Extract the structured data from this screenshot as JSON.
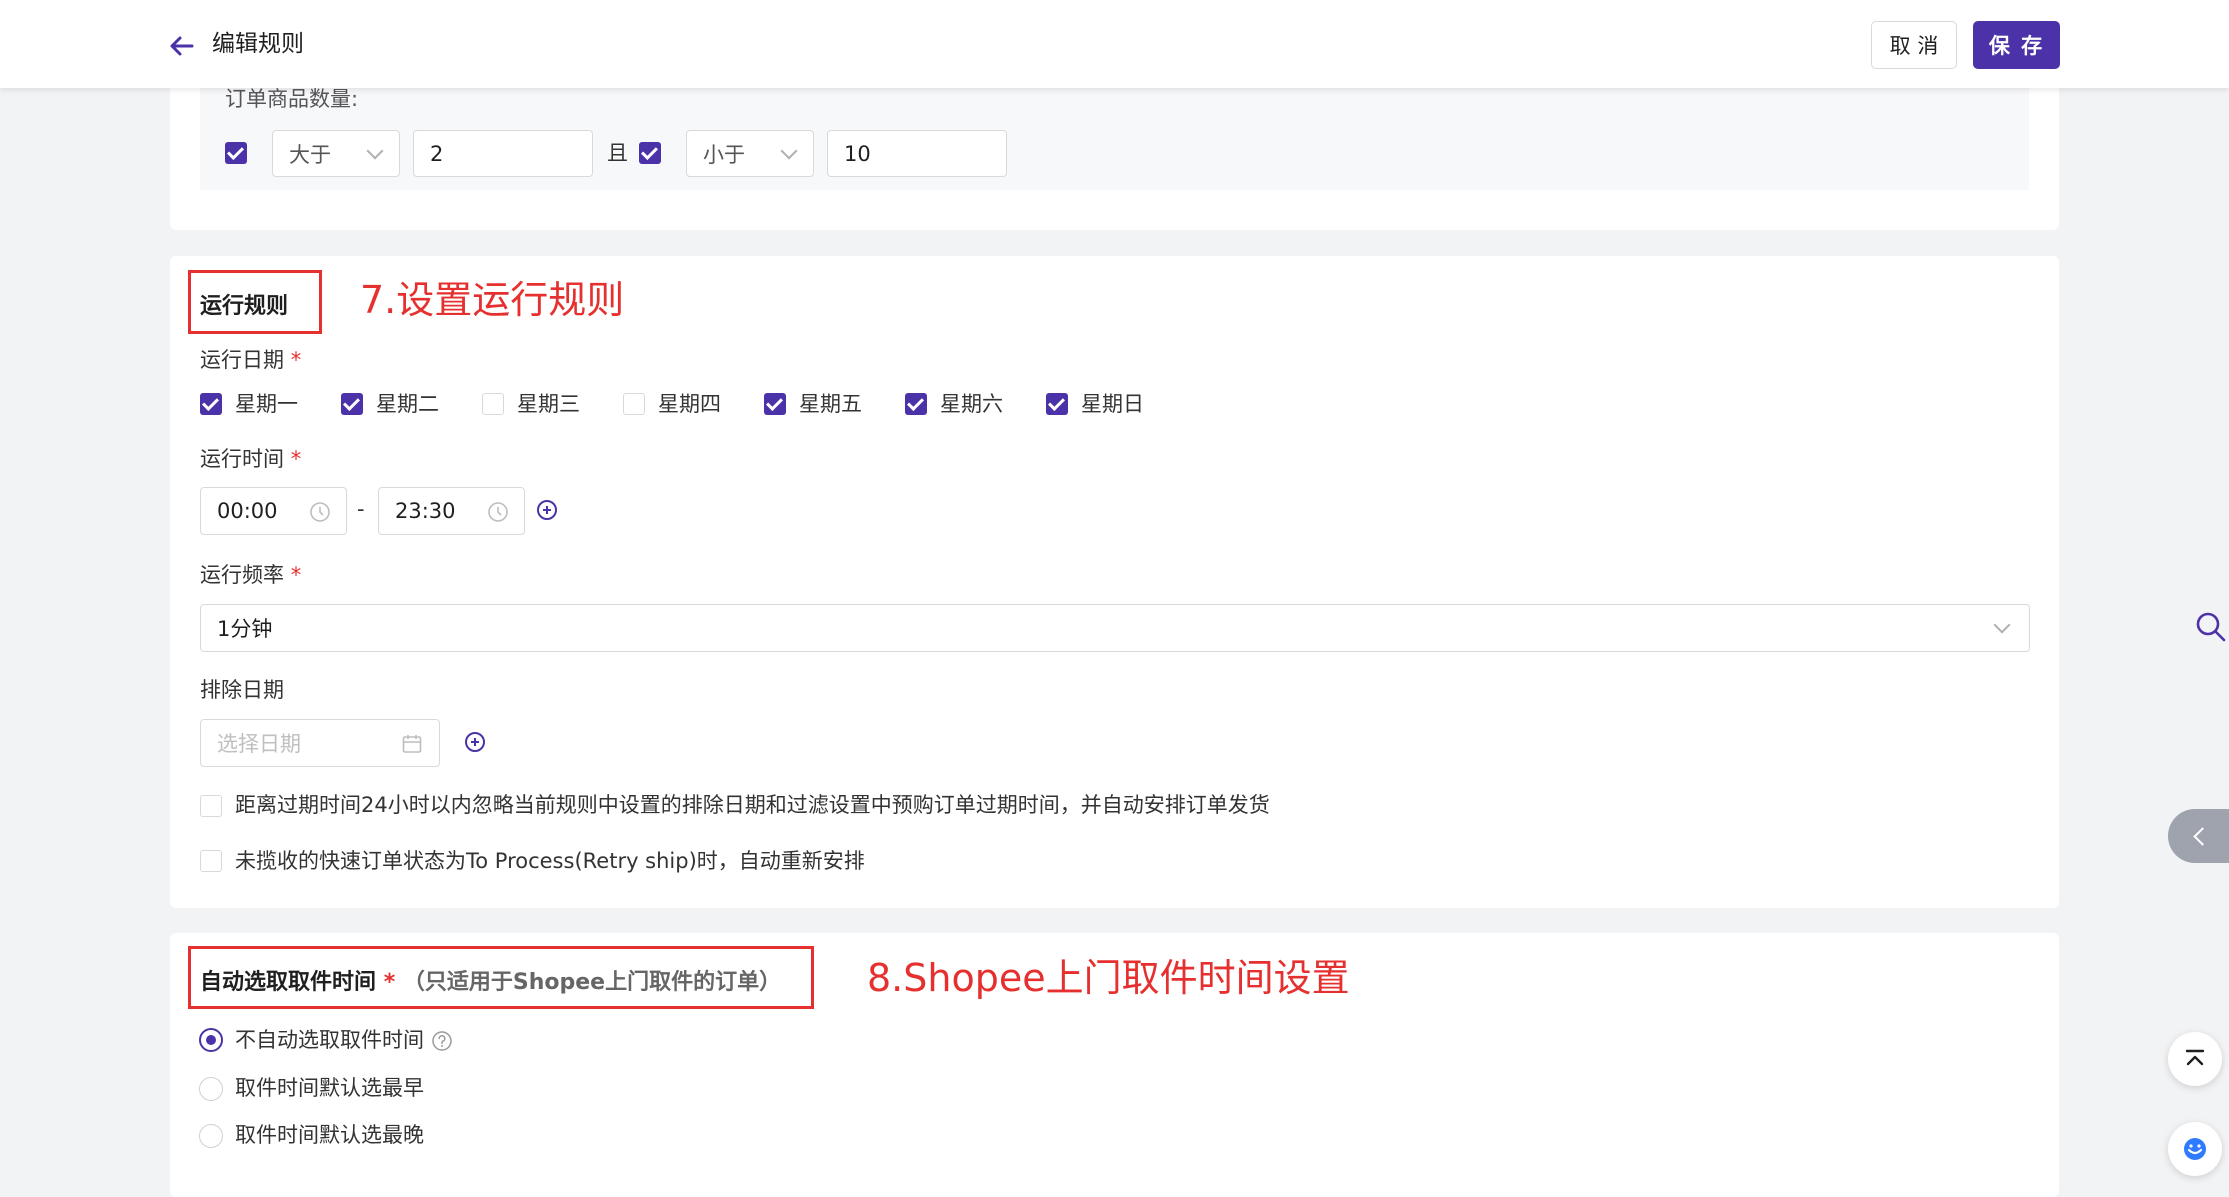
{
  "header": {
    "title": "编辑规则",
    "cancel_label": "取 消",
    "save_label": "保 存"
  },
  "order_qty": {
    "label": "订单商品数量:",
    "op1": "大于",
    "val1": "2",
    "conj": "且",
    "op2": "小于",
    "val2": "10"
  },
  "run_rule": {
    "title": "运行规则",
    "annotation": "7.设置运行规则",
    "days_label": "运行日期",
    "days": [
      {
        "label": "星期一",
        "checked": true
      },
      {
        "label": "星期二",
        "checked": true
      },
      {
        "label": "星期三",
        "checked": false
      },
      {
        "label": "星期四",
        "checked": false
      },
      {
        "label": "星期五",
        "checked": true
      },
      {
        "label": "星期六",
        "checked": true
      },
      {
        "label": "星期日",
        "checked": true
      }
    ],
    "time_label": "运行时间",
    "time_start": "00:00",
    "time_sep": "-",
    "time_end": "23:30",
    "freq_label": "运行频率",
    "freq_value": "1分钟",
    "exclude_label": "排除日期",
    "exclude_placeholder": "选择日期",
    "option1": "距离过期时间24小时以内忽略当前规则中设置的排除日期和过滤设置中预购订单过期时间，并自动安排订单发货",
    "option2": "未揽收的快速订单状态为To Process(Retry ship)时，自动重新安排"
  },
  "pickup": {
    "title": "自动选取取件时间",
    "note": "（只适用于Shopee上门取件的订单）",
    "annotation": "8.Shopee上门取件时间设置",
    "options": [
      {
        "label": "不自动选取取件时间",
        "selected": true
      },
      {
        "label": "取件时间默认选最早",
        "selected": false
      },
      {
        "label": "取件时间默认选最晚",
        "selected": false
      }
    ]
  },
  "required_mark": "*",
  "colors": {
    "primary": "#4b32a8",
    "annotation": "#e5302f"
  }
}
